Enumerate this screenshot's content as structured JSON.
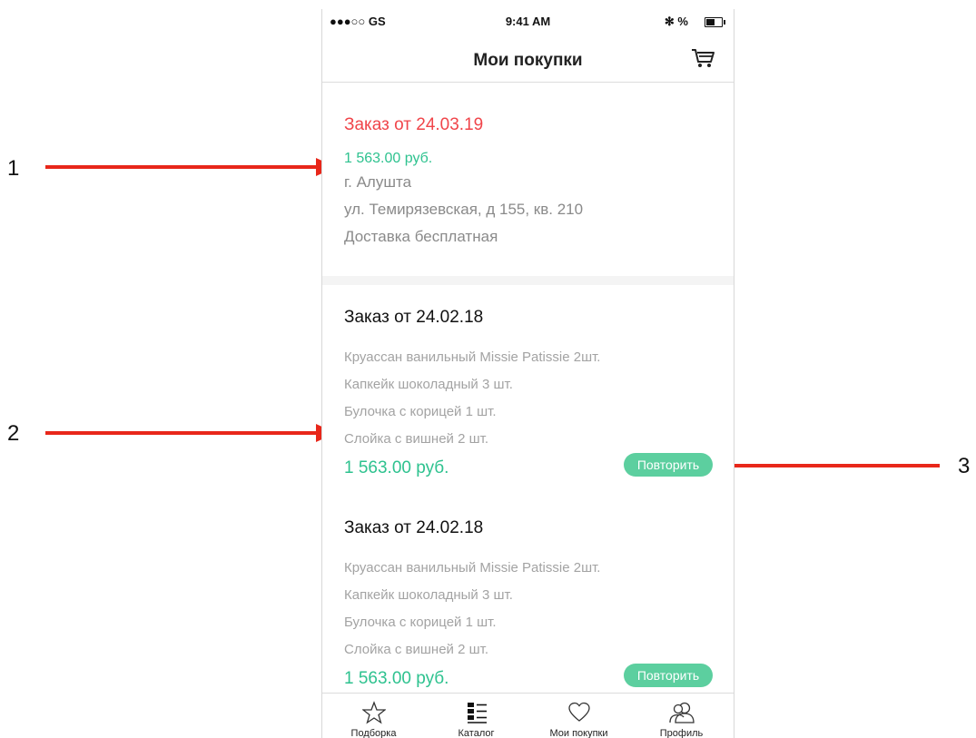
{
  "annotations": {
    "callout_1": "1",
    "callout_2": "2",
    "callout_3": "3"
  },
  "status_bar": {
    "carrier": "●●●○○ GS",
    "time": "9:41 AM",
    "right": "✻ %"
  },
  "nav": {
    "title": "Мои покупки",
    "cart_icon": "cart-icon"
  },
  "current_order": {
    "title": "Заказ от 24.03.19",
    "price": "1 563.00 руб.",
    "city": "г. Алушта",
    "street": "ул. Темирязевская, д 155, кв. 210",
    "delivery": "Доставка бесплатная"
  },
  "past_orders": [
    {
      "title": "Заказ от 24.02.18",
      "items": [
        "Круассан ванильный Missie Patissie 2шт.",
        "Капкейк шоколадный 3 шт.",
        "Булочка с корицей 1 шт.",
        "Слойка с вишней 2 шт."
      ],
      "price": "1 563.00 руб.",
      "repeat_label": "Повторить"
    },
    {
      "title": "Заказ от 24.02.18",
      "items": [
        "Круассан ванильный Missie Patissie 2шт.",
        "Капкейк шоколадный 3 шт.",
        "Булочка с корицей 1 шт.",
        "Слойка с вишней 2 шт."
      ],
      "price": "1 563.00 руб.",
      "repeat_label": "Повторить"
    }
  ],
  "tab_bar": {
    "tabs": [
      {
        "label": "Подборка",
        "icon": "star-icon"
      },
      {
        "label": "Каталог",
        "icon": "list-icon"
      },
      {
        "label": "Мои покупки",
        "icon": "heart-icon"
      },
      {
        "label": "Профиль",
        "icon": "users-icon"
      }
    ]
  },
  "colors": {
    "accent_green": "#2ec28f",
    "button_green": "#5ccf9f",
    "highlight_red": "#f0454a",
    "arrow_red": "#e8271a"
  }
}
